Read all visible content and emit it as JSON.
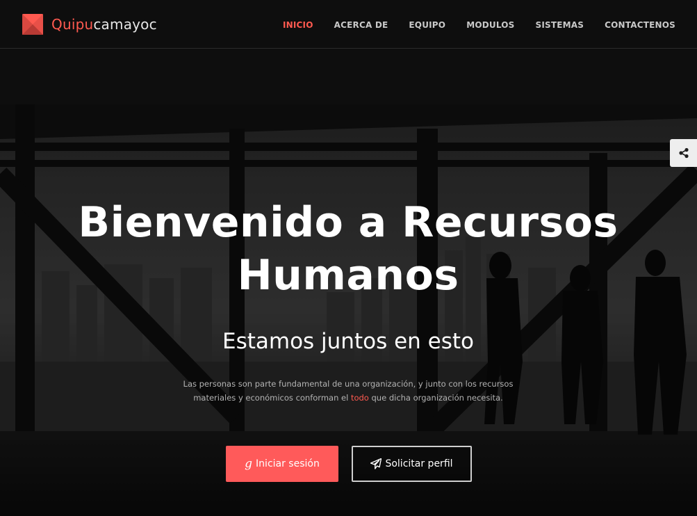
{
  "brand": {
    "name_accent": "Quipu",
    "name_rest": "camayoc",
    "logo_icon": "red-diamond-logo-icon",
    "accent_color": "#ff5a50"
  },
  "nav": {
    "items": [
      {
        "label": "INICIO",
        "active": true
      },
      {
        "label": "ACERCA DE",
        "active": false
      },
      {
        "label": "EQUIPO",
        "active": false
      },
      {
        "label": "MODULOS",
        "active": false
      },
      {
        "label": "SISTEMAS",
        "active": false
      },
      {
        "label": "CONTACTENOS",
        "active": false
      }
    ]
  },
  "share": {
    "icon": "share-icon"
  },
  "hero": {
    "title": "Bienvenido a Recursos Humanos",
    "subtitle": "Estamos juntos en esto",
    "text_before": "Las personas son parte fundamental de una organización, y junto con los recursos materiales y económicos conforman el ",
    "text_highlight": "todo",
    "text_after": " que dicha organización necesita.",
    "buttons": {
      "login_label": "Iniciar sesión",
      "login_icon": "google-icon",
      "login_color": "#ff5a5a",
      "profile_label": "Solicitar perfil",
      "profile_icon": "paper-plane-icon"
    }
  }
}
